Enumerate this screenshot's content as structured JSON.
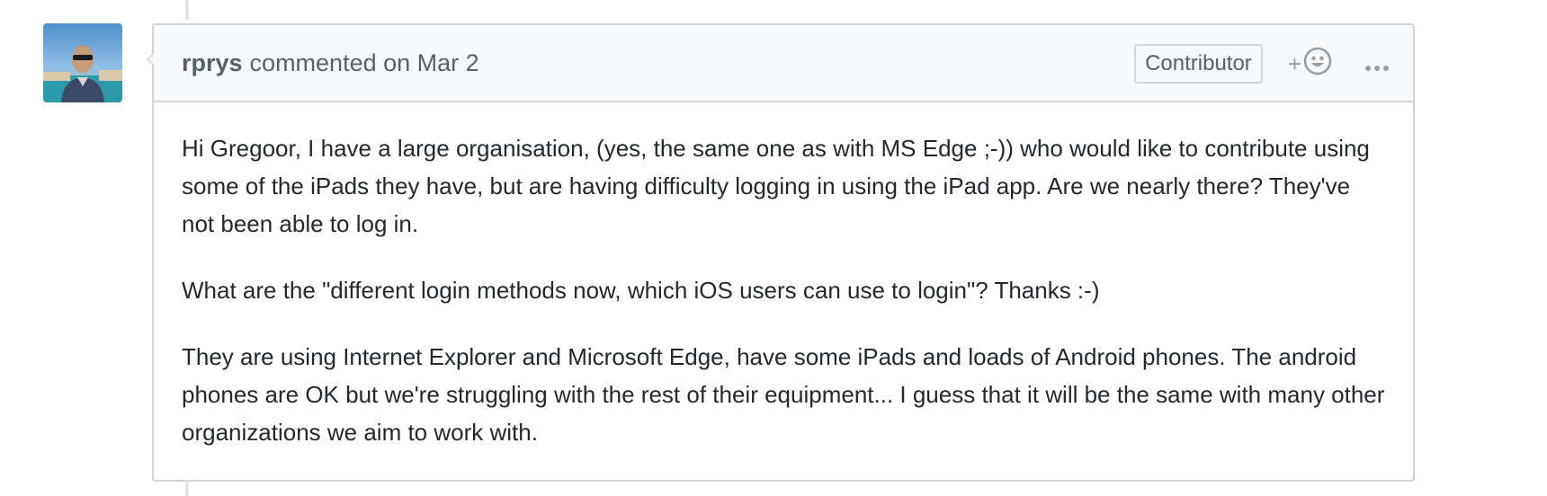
{
  "comment": {
    "author": "rprys",
    "action_text": "commented on Mar 2",
    "badge": "Contributor",
    "reaction_plus": "+",
    "paragraphs": [
      "Hi Gregoor, I have a large organisation, (yes, the same one as with MS Edge ;-)) who would like to contribute using some of the iPads they have, but are having difficulty logging in using the iPad app. Are we nearly there? They've not been able to log in.",
      "What are the \"different login methods now, which iOS users can use to login\"? Thanks :-)",
      "They are using Internet Explorer and Microsoft Edge, have some iPads and loads of Android phones. The android phones are OK but we're struggling with the rest of their equipment... I guess that it will be the same with many other organizations we aim to work with."
    ]
  },
  "icons": {
    "avatar": "user-avatar",
    "reaction": "smiley-icon",
    "more": "kebab-horizontal-icon"
  },
  "colors": {
    "border": "#d1d5da",
    "header_bg": "#f6f8fa",
    "text": "#24292e",
    "muted": "#586069"
  }
}
